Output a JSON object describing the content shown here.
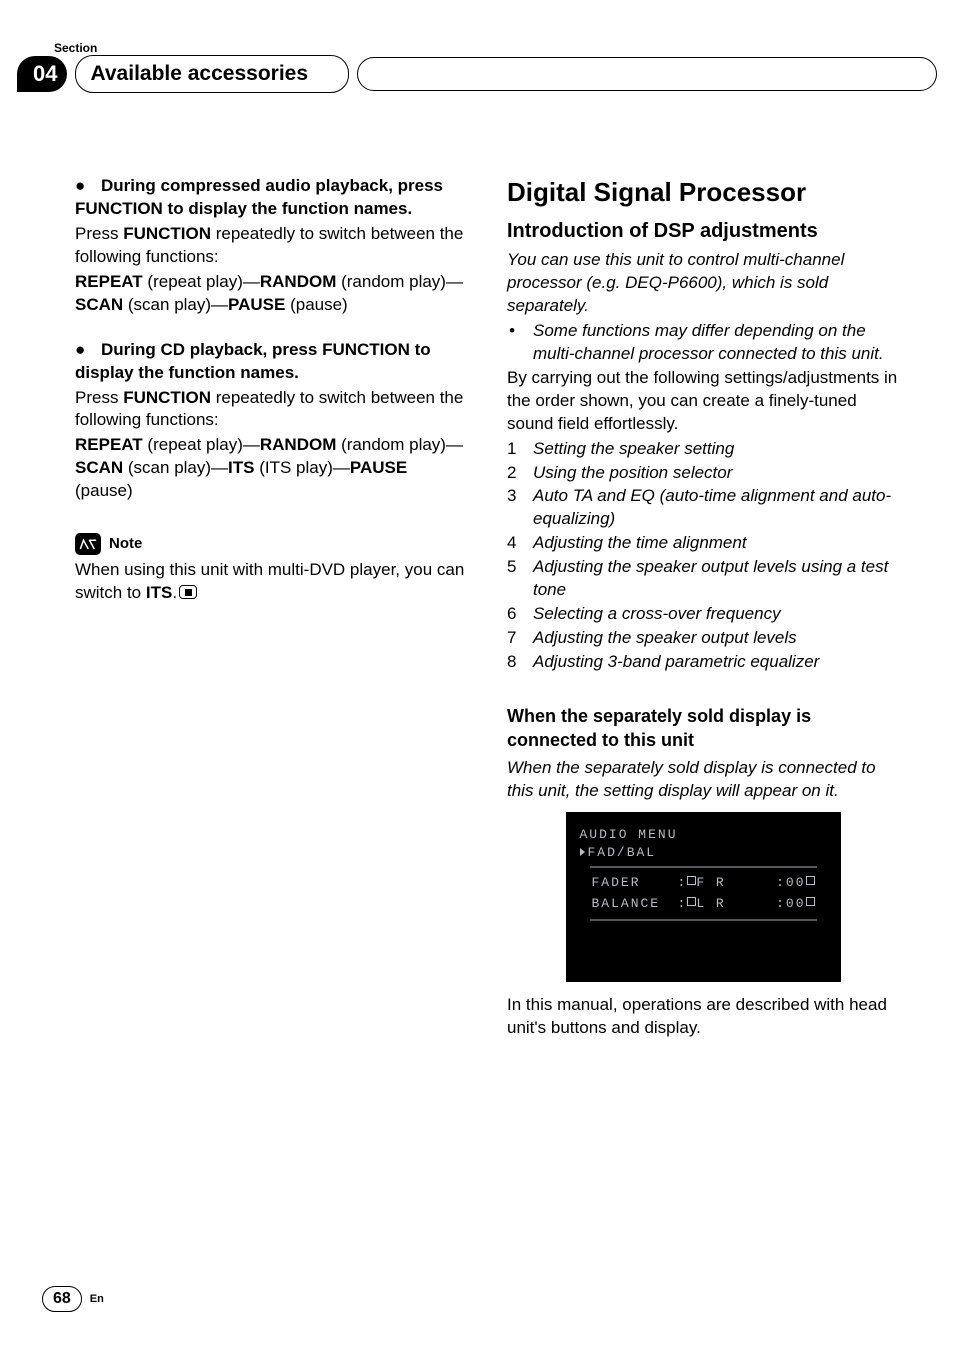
{
  "header": {
    "section_label": "Section",
    "section_number": "04",
    "title": "Available accessories"
  },
  "left": {
    "block1": {
      "heading": "During compressed audio playback, press FUNCTION to display the function names.",
      "p1_a": "Press ",
      "p1_b": "FUNCTION",
      "p1_c": " repeatedly to switch between the following functions:",
      "seq_a": "REPEAT",
      "seq_a2": " (repeat play)—",
      "seq_b": "RANDOM",
      "seq_b2": " (random play)—",
      "seq_c": "SCAN",
      "seq_c2": " (scan play)—",
      "seq_d": "PAUSE",
      "seq_d2": " (pause)"
    },
    "block2": {
      "heading": "During CD playback, press FUNCTION to display the function names.",
      "p1_a": "Press ",
      "p1_b": "FUNCTION",
      "p1_c": " repeatedly to switch between the following functions:",
      "seq_a": "REPEAT",
      "seq_a2": " (repeat play)—",
      "seq_b": "RANDOM",
      "seq_b2": " (random play)—",
      "seq_c": "SCAN",
      "seq_c2": " (scan play)—",
      "seq_d": "ITS",
      "seq_d2": " (ITS play)—",
      "seq_e": "PAUSE",
      "seq_e2": " (pause)"
    },
    "note": {
      "label": "Note",
      "text_a": "When using this unit with multi-DVD player, you can switch to ",
      "text_b": "ITS",
      "text_c": "."
    }
  },
  "right": {
    "h1": "Digital Signal Processor",
    "h2": "Introduction of DSP adjustments",
    "intro_italic": "You can use this unit to control multi-channel processor (e.g. DEQ-P6600), which is sold separately.",
    "sub_bullet": "Some functions may differ depending on the multi-channel processor connected to this unit.",
    "intro2": "By carrying out the following settings/adjustments in the order shown, you can create a finely-tuned sound field effortlessly.",
    "steps": [
      "Setting the speaker setting",
      "Using the position selector",
      "Auto TA and EQ (auto-time alignment and auto-equalizing)",
      "Adjusting the time alignment",
      "Adjusting the speaker output levels using a test tone",
      "Selecting a cross-over frequency",
      "Adjusting the speaker output levels",
      "Adjusting 3-band parametric equalizer"
    ],
    "subheading": "When the separately sold display is connected to this unit",
    "sub_intro": "When the separately sold display is connected to this unit, the setting display will appear on it.",
    "display": {
      "title": "AUDIO MENU",
      "breadcrumb": "FAD/BAL",
      "row1": {
        "label": "FADER",
        "mid": "F R",
        "val": "00"
      },
      "row2": {
        "label": "BALANCE",
        "mid": "L R",
        "val": "00"
      }
    },
    "outro": "In this manual, operations are described with head unit's buttons and display."
  },
  "footer": {
    "page": "68",
    "lang": "En"
  }
}
